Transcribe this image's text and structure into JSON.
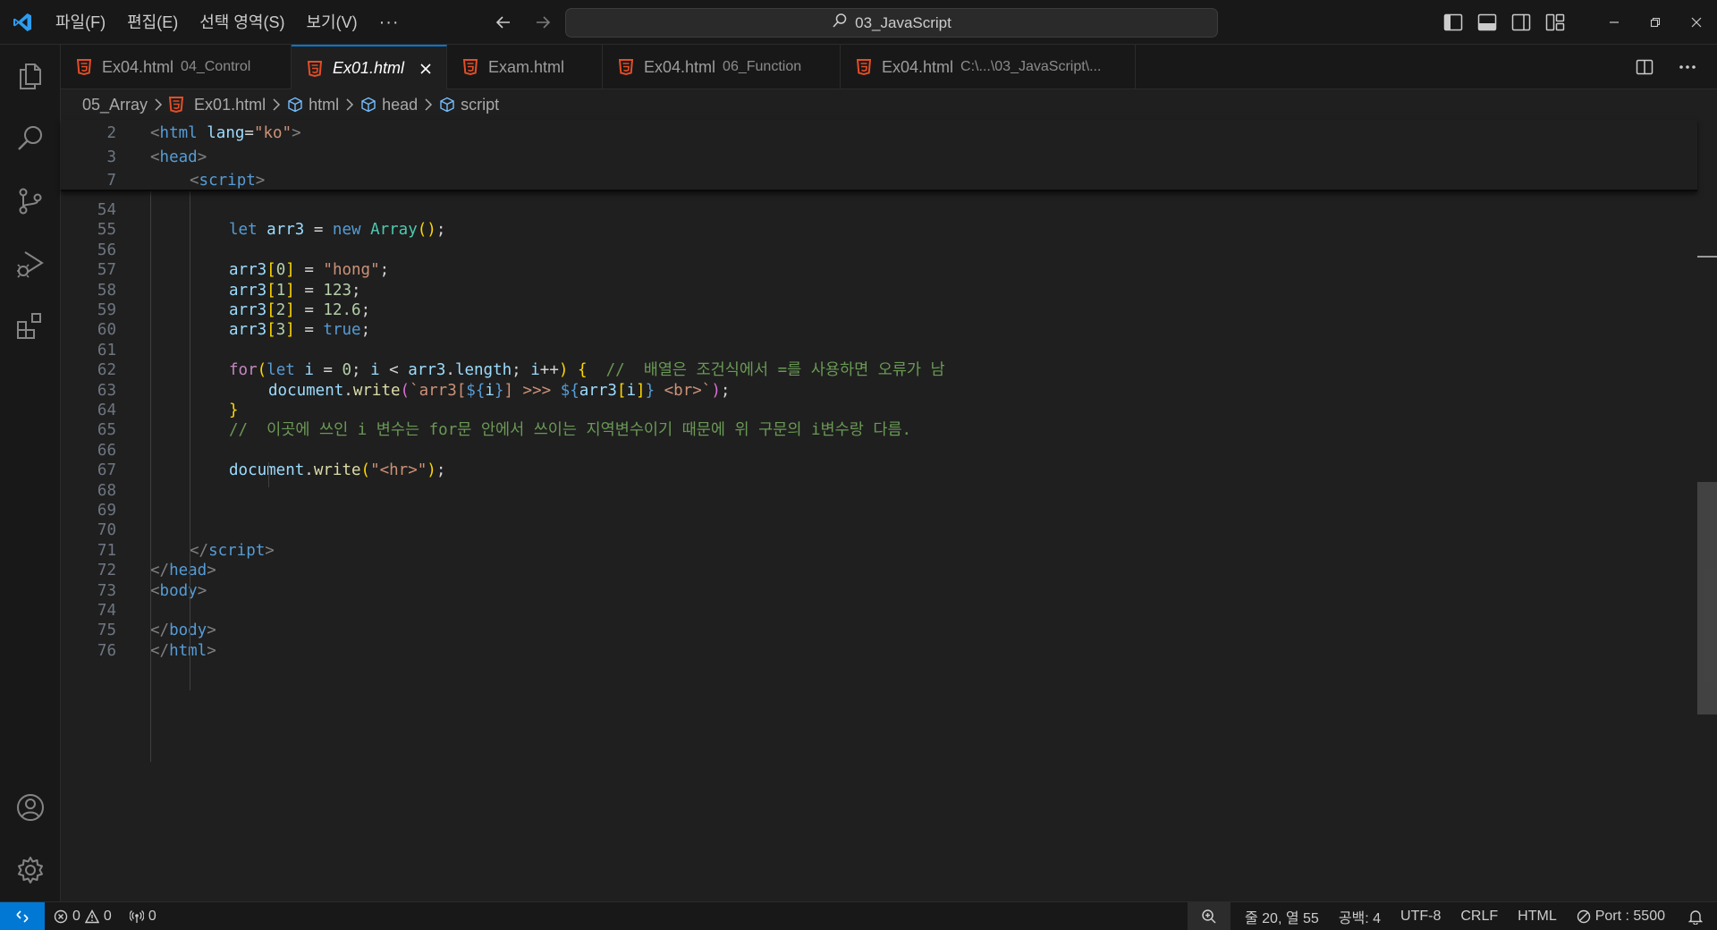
{
  "titlebar": {
    "menus": [
      "파일(F)",
      "편집(E)",
      "선택 영역(S)",
      "보기(V)"
    ],
    "more": "···",
    "search_text": "03_JavaScript"
  },
  "tabs": [
    {
      "name": "Ex04.html",
      "desc": "04_Control",
      "active": false
    },
    {
      "name": "Ex01.html",
      "desc": "",
      "active": true
    },
    {
      "name": "Exam.html",
      "desc": "",
      "active": false
    },
    {
      "name": "Ex04.html",
      "desc": "06_Function",
      "active": false
    },
    {
      "name": "Ex04.html",
      "desc": "C:\\...\\03_JavaScript\\...",
      "active": false
    }
  ],
  "breadcrumb": {
    "folder": "05_Array",
    "file": "Ex01.html",
    "html": "html",
    "head": "head",
    "script": "script"
  },
  "editor": {
    "sticky_lines": [
      {
        "num": "2",
        "tokens": [
          [
            "t-br",
            "<"
          ],
          [
            "t-tag",
            "html"
          ],
          [
            "t-plain",
            " "
          ],
          [
            "t-attr",
            "lang"
          ],
          [
            "t-plain",
            "="
          ],
          [
            "t-str",
            "\"ko\""
          ],
          [
            "t-br",
            ">"
          ]
        ],
        "indent": 0
      },
      {
        "num": "3",
        "tokens": [
          [
            "t-br",
            "<"
          ],
          [
            "t-tag",
            "head"
          ],
          [
            "t-br",
            ">"
          ]
        ],
        "indent": 0
      },
      {
        "num": "7",
        "tokens": [
          [
            "t-br",
            "<"
          ],
          [
            "t-tag",
            "script"
          ],
          [
            "t-br",
            ">"
          ]
        ],
        "indent": 1
      }
    ],
    "lines": [
      {
        "num": "54",
        "tokens": [],
        "indent": 0
      },
      {
        "num": "55",
        "tokens": [
          [
            "t-kw",
            "let"
          ],
          [
            "t-plain",
            " "
          ],
          [
            "t-var",
            "arr3"
          ],
          [
            "t-plain",
            " = "
          ],
          [
            "t-kw",
            "new"
          ],
          [
            "t-plain",
            " "
          ],
          [
            "t-cls",
            "Array"
          ],
          [
            "t-paren",
            "()"
          ],
          [
            "t-plain",
            ";"
          ]
        ],
        "indent": 2
      },
      {
        "num": "56",
        "tokens": [],
        "indent": 0
      },
      {
        "num": "57",
        "tokens": [
          [
            "t-var",
            "arr3"
          ],
          [
            "t-paren",
            "["
          ],
          [
            "t-num",
            "0"
          ],
          [
            "t-paren",
            "]"
          ],
          [
            "t-plain",
            " = "
          ],
          [
            "t-str",
            "\"hong\""
          ],
          [
            "t-plain",
            ";"
          ]
        ],
        "indent": 2
      },
      {
        "num": "58",
        "tokens": [
          [
            "t-var",
            "arr3"
          ],
          [
            "t-paren",
            "["
          ],
          [
            "t-num",
            "1"
          ],
          [
            "t-paren",
            "]"
          ],
          [
            "t-plain",
            " = "
          ],
          [
            "t-num",
            "123"
          ],
          [
            "t-plain",
            ";"
          ]
        ],
        "indent": 2
      },
      {
        "num": "59",
        "tokens": [
          [
            "t-var",
            "arr3"
          ],
          [
            "t-paren",
            "["
          ],
          [
            "t-num",
            "2"
          ],
          [
            "t-paren",
            "]"
          ],
          [
            "t-plain",
            " = "
          ],
          [
            "t-num",
            "12.6"
          ],
          [
            "t-plain",
            ";"
          ]
        ],
        "indent": 2
      },
      {
        "num": "60",
        "tokens": [
          [
            "t-var",
            "arr3"
          ],
          [
            "t-paren",
            "["
          ],
          [
            "t-num",
            "3"
          ],
          [
            "t-paren",
            "]"
          ],
          [
            "t-plain",
            " = "
          ],
          [
            "t-kw",
            "true"
          ],
          [
            "t-plain",
            ";"
          ]
        ],
        "indent": 2
      },
      {
        "num": "61",
        "tokens": [],
        "indent": 0
      },
      {
        "num": "62",
        "tokens": [
          [
            "t-ctl",
            "for"
          ],
          [
            "t-paren",
            "("
          ],
          [
            "t-kw",
            "let"
          ],
          [
            "t-plain",
            " "
          ],
          [
            "t-var",
            "i"
          ],
          [
            "t-plain",
            " = "
          ],
          [
            "t-num",
            "0"
          ],
          [
            "t-plain",
            "; "
          ],
          [
            "t-var",
            "i"
          ],
          [
            "t-plain",
            " < "
          ],
          [
            "t-var",
            "arr3"
          ],
          [
            "t-plain",
            "."
          ],
          [
            "t-var",
            "length"
          ],
          [
            "t-plain",
            "; "
          ],
          [
            "t-var",
            "i"
          ],
          [
            "t-plain",
            "++"
          ],
          [
            "t-paren",
            ")"
          ],
          [
            "t-plain",
            " "
          ],
          [
            "t-paren",
            "{"
          ],
          [
            "t-plain",
            "  "
          ],
          [
            "t-com",
            "//  배열은 조건식에서 =를 사용하면 오류가 남"
          ]
        ],
        "indent": 2
      },
      {
        "num": "63",
        "tokens": [
          [
            "t-var",
            "document"
          ],
          [
            "t-plain",
            "."
          ],
          [
            "t-fn",
            "write"
          ],
          [
            "t-brace2",
            "("
          ],
          [
            "t-str",
            "`arr3["
          ],
          [
            "t-kw",
            "${"
          ],
          [
            "t-var",
            "i"
          ],
          [
            "t-kw",
            "}"
          ],
          [
            "t-str",
            "] >>> "
          ],
          [
            "t-kw",
            "${"
          ],
          [
            "t-var",
            "arr3"
          ],
          [
            "t-paren",
            "["
          ],
          [
            "t-var",
            "i"
          ],
          [
            "t-paren",
            "]"
          ],
          [
            "t-kw",
            "}"
          ],
          [
            "t-str",
            " <br>`"
          ],
          [
            "t-brace2",
            ")"
          ],
          [
            "t-plain",
            ";"
          ]
        ],
        "indent": 3
      },
      {
        "num": "64",
        "tokens": [
          [
            "t-paren",
            "}"
          ]
        ],
        "indent": 2
      },
      {
        "num": "65",
        "tokens": [
          [
            "t-com",
            "//  이곳에 쓰인 i 변수는 for문 안에서 쓰이는 지역변수이기 때문에 위 구문의 i변수랑 다름."
          ]
        ],
        "indent": 2
      },
      {
        "num": "66",
        "tokens": [],
        "indent": 0
      },
      {
        "num": "67",
        "tokens": [
          [
            "t-var",
            "document"
          ],
          [
            "t-plain",
            "."
          ],
          [
            "t-fn",
            "write"
          ],
          [
            "t-paren",
            "("
          ],
          [
            "t-str",
            "\"<hr>\""
          ],
          [
            "t-paren",
            ")"
          ],
          [
            "t-plain",
            ";"
          ]
        ],
        "indent": 2
      },
      {
        "num": "68",
        "tokens": [],
        "indent": 0
      },
      {
        "num": "69",
        "tokens": [],
        "indent": 0
      },
      {
        "num": "70",
        "tokens": [],
        "indent": 0
      },
      {
        "num": "71",
        "tokens": [
          [
            "t-br",
            "</"
          ],
          [
            "t-tag",
            "script"
          ],
          [
            "t-br",
            ">"
          ]
        ],
        "indent": 1
      },
      {
        "num": "72",
        "tokens": [
          [
            "t-br",
            "</"
          ],
          [
            "t-tag",
            "head"
          ],
          [
            "t-br",
            ">"
          ]
        ],
        "indent": 0
      },
      {
        "num": "73",
        "tokens": [
          [
            "t-br",
            "<"
          ],
          [
            "t-tag",
            "body"
          ],
          [
            "t-br",
            ">"
          ]
        ],
        "indent": 0
      },
      {
        "num": "74",
        "tokens": [],
        "indent": 0
      },
      {
        "num": "75",
        "tokens": [
          [
            "t-br",
            "</"
          ],
          [
            "t-tag",
            "body"
          ],
          [
            "t-br",
            ">"
          ]
        ],
        "indent": 0
      },
      {
        "num": "76",
        "tokens": [
          [
            "t-br",
            "</"
          ],
          [
            "t-tag",
            "html"
          ],
          [
            "t-br",
            ">"
          ]
        ],
        "indent": 0
      }
    ]
  },
  "statusbar": {
    "errors": "0",
    "warnings": "0",
    "ports": "0",
    "position": "줄 20, 열 55",
    "spaces": "공백: 4",
    "encoding": "UTF-8",
    "eol": "CRLF",
    "language": "HTML",
    "port": "Port : 5500"
  },
  "colors": {
    "accent": "#0078d4",
    "html_icon": "#e44d26",
    "vscode_logo": "#2d9cf0"
  }
}
